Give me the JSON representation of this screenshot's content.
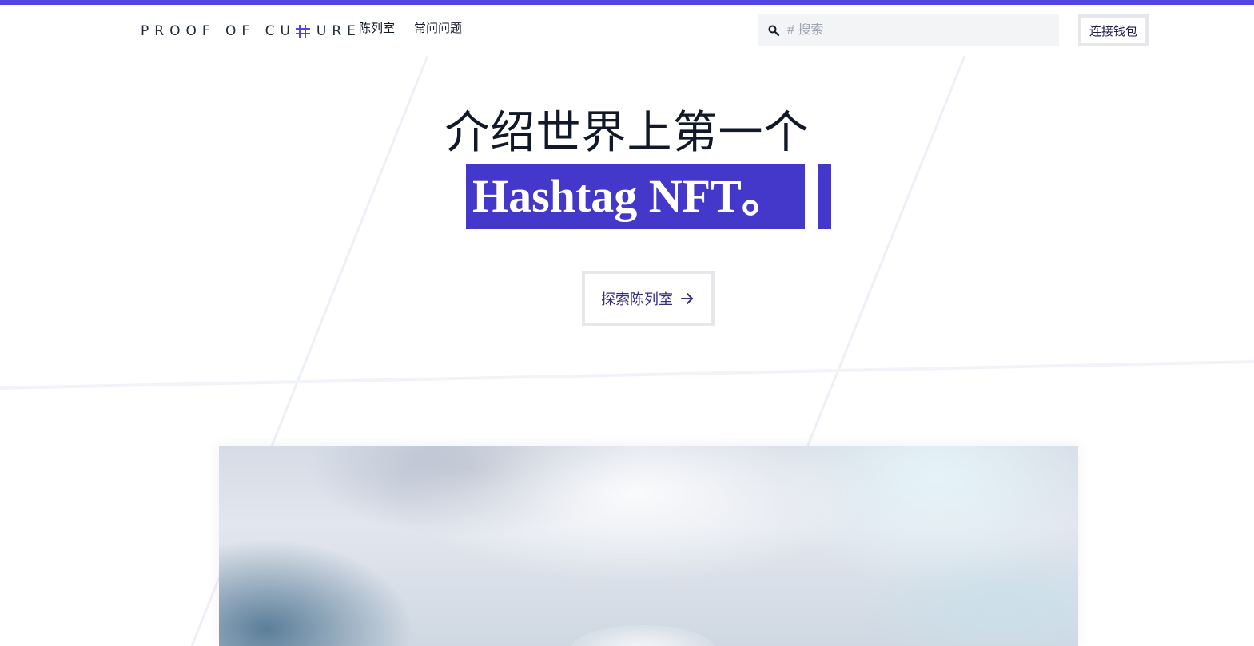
{
  "brand": {
    "logo_text_left": "PROOF OF CU",
    "logo_text_right": "URE",
    "logo_hash_color": "#4f46e5",
    "accent_color": "#4f46e5",
    "highlight_color": "#4338ca"
  },
  "nav": {
    "items": [
      {
        "label": "陈列室"
      },
      {
        "label": "常问问题"
      }
    ]
  },
  "search": {
    "placeholder": "# 搜索",
    "value": "",
    "icon": "search-icon"
  },
  "wallet": {
    "label": "连接钱包"
  },
  "hero": {
    "title": "介绍世界上第一个",
    "highlight": "Hashtag NFT。",
    "cta_label": "探索陈列室",
    "cta_icon": "arrow-right-icon"
  }
}
